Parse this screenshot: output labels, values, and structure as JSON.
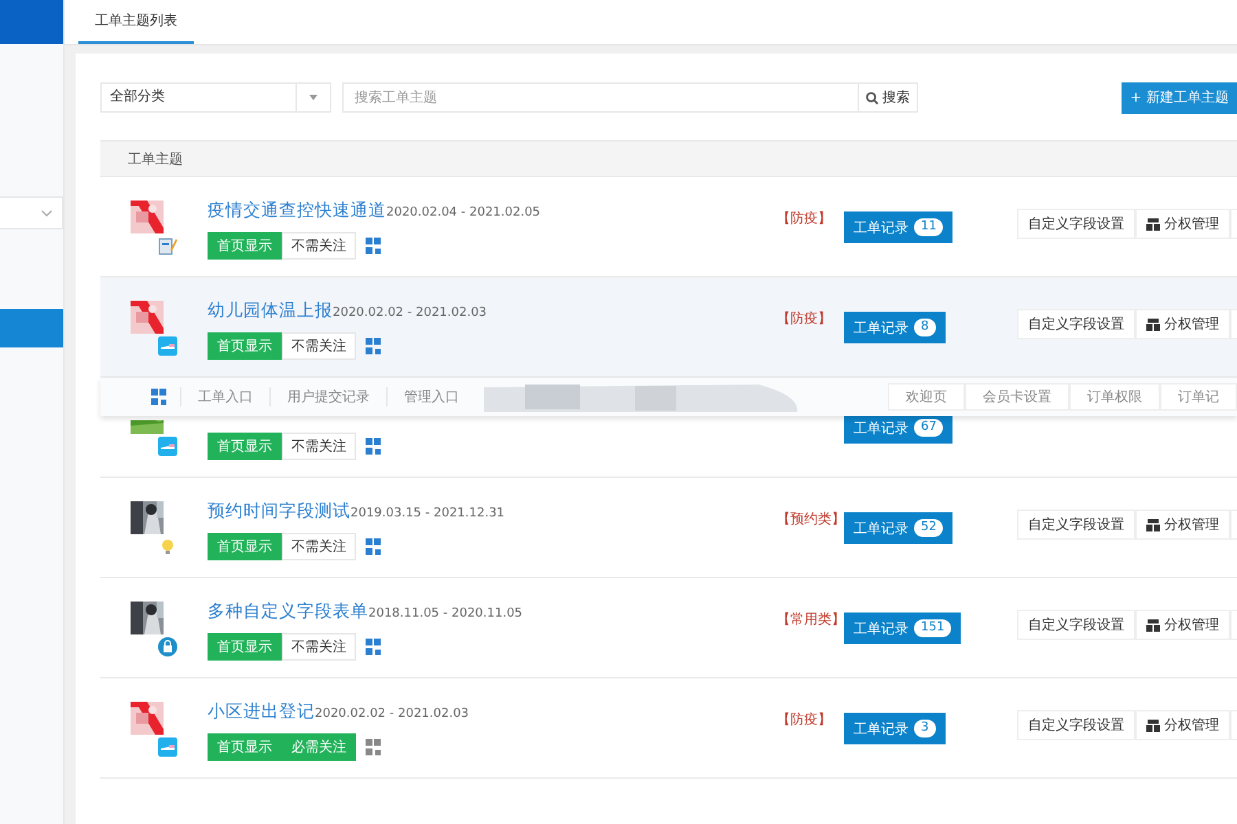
{
  "sidebar": {
    "items": [
      {
        "selected": false,
        "kind": "dropdown"
      },
      {
        "selected": true,
        "kind": "link"
      }
    ]
  },
  "tabs": [
    {
      "label": "工单主题列表",
      "selected": true
    }
  ],
  "filter": {
    "category": "全部分类",
    "search_placeholder": "搜索工单主题",
    "search_button": "搜索",
    "new_button": "+ 新建工单主题"
  },
  "table": {
    "columns": [
      "工单主题"
    ],
    "rows": [
      {
        "title": "疫情交通查控快速通道",
        "dates": "2020.02.04 - 2021.02.05",
        "homepage": {
          "label": "首页显示",
          "on": true
        },
        "follow": {
          "label": "不需关注",
          "on": false
        },
        "qr_active": true,
        "tag": "【防疫】",
        "records_label": "工单记录",
        "records_count": "11",
        "actions": [
          "自定义字段设置",
          "分权管理"
        ],
        "highlighted": false
      },
      {
        "title": "幼儿园体温上报",
        "dates": "2020.02.02 - 2021.02.03",
        "homepage": {
          "label": "首页显示",
          "on": true
        },
        "follow": {
          "label": "不需关注",
          "on": false
        },
        "qr_active": true,
        "tag": "【防疫】",
        "records_label": "工单记录",
        "records_count": "8",
        "actions": [
          "自定义字段设置",
          "分权管理"
        ],
        "highlighted": true
      },
      {
        "homepage": {
          "label": "首页显示",
          "on": true
        },
        "follow": {
          "label": "不需关注",
          "on": false
        },
        "qr_active": true,
        "records_label": "工单记录",
        "records_count": "67",
        "highlighted": false,
        "popover": {
          "items": [
            "工单入口",
            "用户提交记录",
            "管理入口"
          ],
          "right_items": [
            "欢迎页",
            "会员卡设置",
            "订单权限",
            "订单记"
          ]
        }
      },
      {
        "title": "预约时间字段测试",
        "dates": "2019.03.15 - 2021.12.31",
        "homepage": {
          "label": "首页显示",
          "on": true
        },
        "follow": {
          "label": "不需关注",
          "on": false
        },
        "qr_active": true,
        "tag": "【预约类】",
        "records_label": "工单记录",
        "records_count": "52",
        "actions": [
          "自定义字段设置",
          "分权管理"
        ],
        "highlighted": false
      },
      {
        "title": "多种自定义字段表单",
        "dates": "2018.11.05 - 2020.11.05",
        "homepage": {
          "label": "首页显示",
          "on": true
        },
        "follow": {
          "label": "不需关注",
          "on": false
        },
        "qr_active": true,
        "tag": "【常用类】",
        "records_label": "工单记录",
        "records_count": "151",
        "actions": [
          "自定义字段设置",
          "分权管理"
        ],
        "highlighted": false
      },
      {
        "title": "小区进出登记",
        "dates": "2020.02.02 - 2021.02.03",
        "homepage": {
          "label": "首页显示",
          "on": true
        },
        "follow": {
          "label": "必需关注",
          "on": true
        },
        "qr_active": false,
        "tag": "【防疫】",
        "records_label": "工单记录",
        "records_count": "3",
        "actions": [
          "自定义字段设置",
          "分权管理"
        ],
        "highlighted": false
      }
    ]
  }
}
